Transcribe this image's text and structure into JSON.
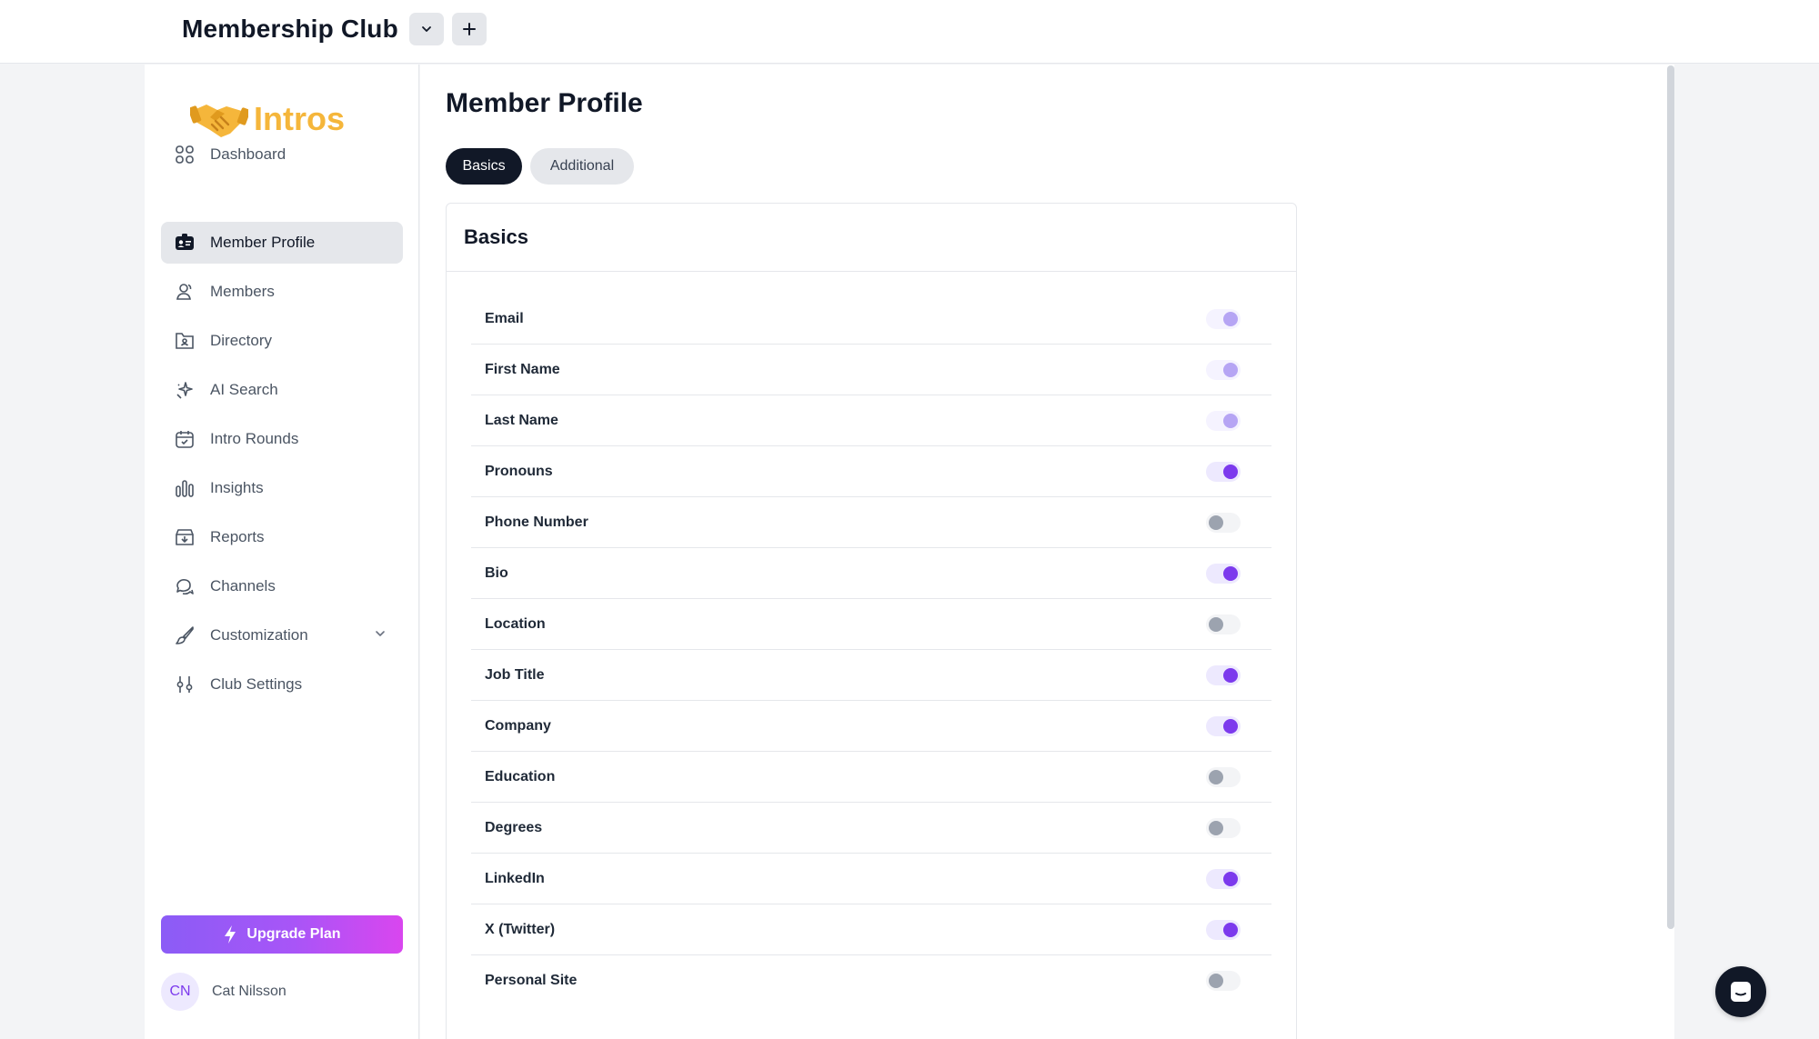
{
  "header": {
    "club_title": "Membership Club"
  },
  "sidebar": {
    "logo_text": "Intros",
    "items": [
      {
        "label": "Dashboard",
        "icon": "grid-icon"
      },
      {
        "label": "Member Profile",
        "icon": "id-card-icon",
        "active": true
      },
      {
        "label": "Members",
        "icon": "users-icon"
      },
      {
        "label": "Directory",
        "icon": "directory-icon"
      },
      {
        "label": "AI Search",
        "icon": "sparkles-icon"
      },
      {
        "label": "Intro Rounds",
        "icon": "calendar-icon"
      },
      {
        "label": "Insights",
        "icon": "bar-chart-icon"
      },
      {
        "label": "Reports",
        "icon": "download-box-icon"
      },
      {
        "label": "Channels",
        "icon": "chat-bubbles-icon"
      },
      {
        "label": "Customization",
        "icon": "brush-icon",
        "expandable": true
      },
      {
        "label": "Club Settings",
        "icon": "sliders-icon"
      }
    ],
    "upgrade_label": "Upgrade Plan",
    "user": {
      "initials": "CN",
      "name": "Cat Nilsson"
    }
  },
  "main": {
    "title": "Member Profile",
    "tabs": [
      {
        "label": "Basics",
        "active": true
      },
      {
        "label": "Additional",
        "active": false
      }
    ],
    "card_title": "Basics",
    "fields": [
      {
        "label": "Email",
        "state": "on-disabled"
      },
      {
        "label": "First Name",
        "state": "on-disabled"
      },
      {
        "label": "Last Name",
        "state": "on-disabled"
      },
      {
        "label": "Pronouns",
        "state": "on"
      },
      {
        "label": "Phone Number",
        "state": "off"
      },
      {
        "label": "Bio",
        "state": "on"
      },
      {
        "label": "Location",
        "state": "off"
      },
      {
        "label": "Job Title",
        "state": "on"
      },
      {
        "label": "Company",
        "state": "on"
      },
      {
        "label": "Education",
        "state": "off"
      },
      {
        "label": "Degrees",
        "state": "off"
      },
      {
        "label": "LinkedIn",
        "state": "on"
      },
      {
        "label": "X (Twitter)",
        "state": "on"
      },
      {
        "label": "Personal Site",
        "state": "off"
      }
    ]
  },
  "colors": {
    "accent": "#7c3aed",
    "logo": "#f5b63b",
    "dark": "#111827"
  }
}
